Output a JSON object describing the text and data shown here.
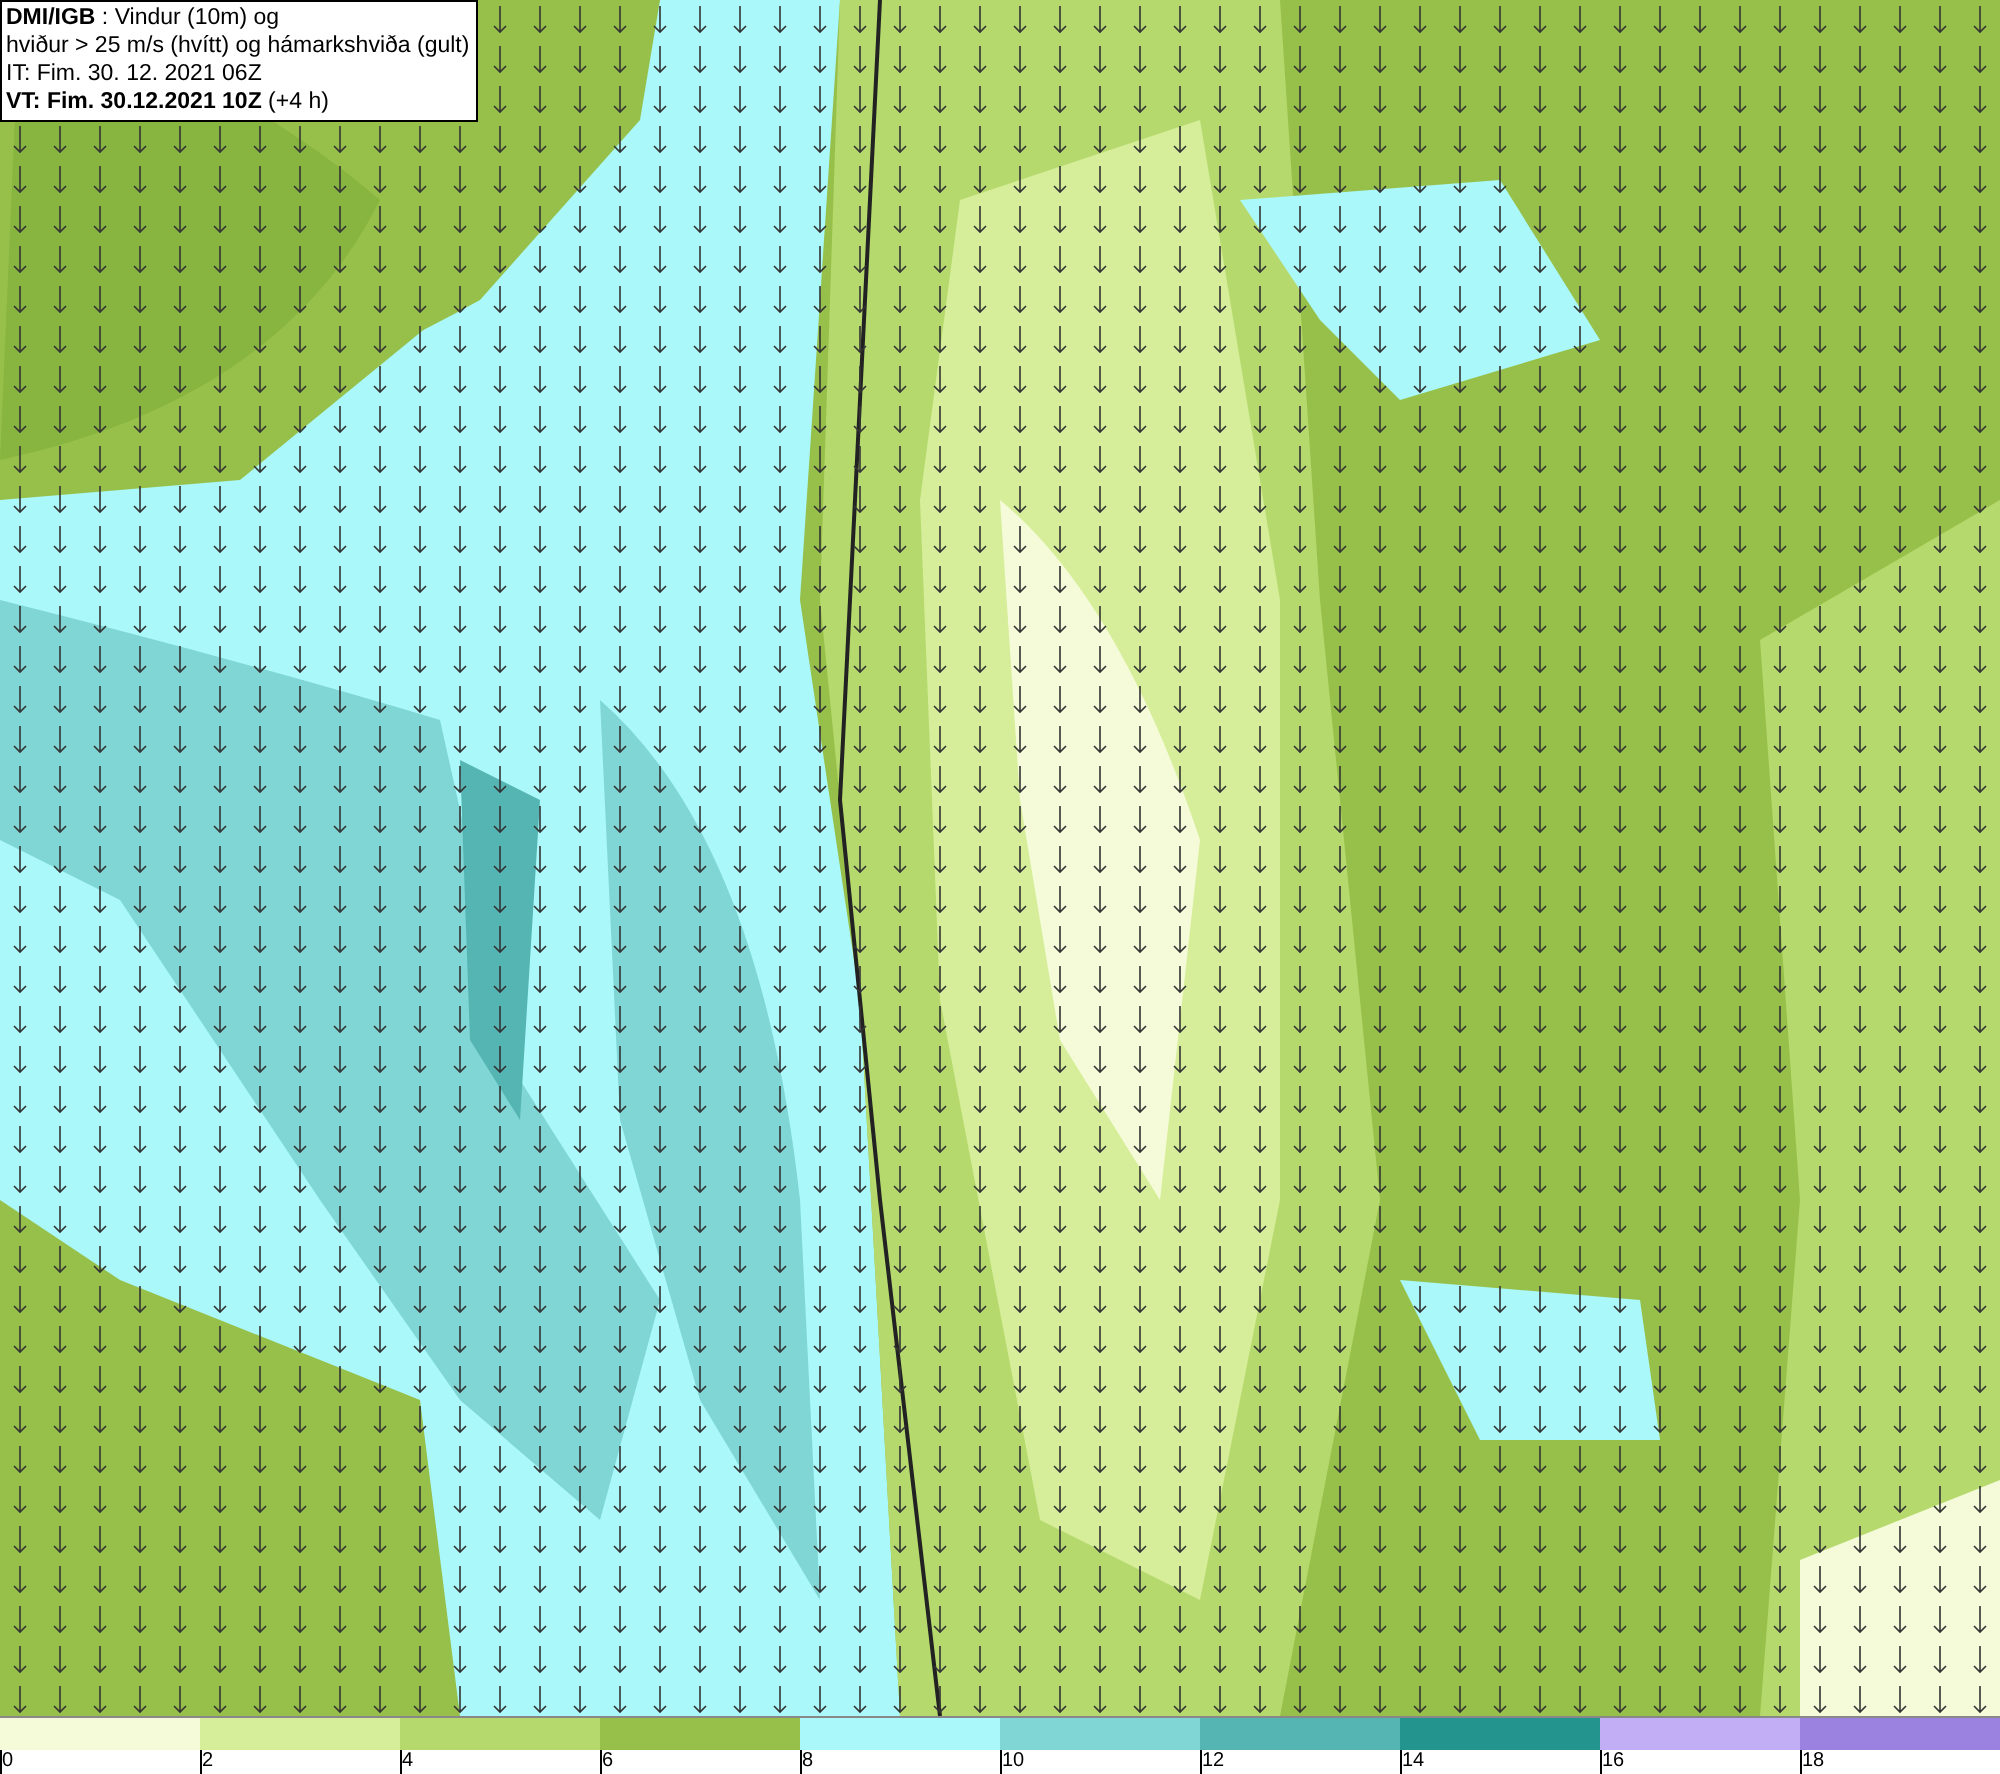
{
  "header": {
    "lines": [
      "**DMI/IGB** : Vindur (10m) og",
      "hviður > 25 m/s (hvítt) og hámarkshviða (gult)",
      "IT: Fim. 30. 12. 2021 06Z",
      "**VT: Fim. 30.12.2021 10Z** (+4 h)"
    ]
  },
  "legend": {
    "bins": [
      {
        "label": "0",
        "color": "#f5fbd8"
      },
      {
        "label": "2",
        "color": "#d6ee9a"
      },
      {
        "label": "4",
        "color": "#b5d96c"
      },
      {
        "label": "6",
        "color": "#97c04a"
      },
      {
        "label": "8",
        "color": "#aaf8fa"
      },
      {
        "label": "10",
        "color": "#7fd6d4"
      },
      {
        "label": "12",
        "color": "#55b5b3"
      },
      {
        "label": "14",
        "color": "#24948e"
      },
      {
        "label": "16",
        "color": "#c2aef5"
      },
      {
        "label": "18",
        "color": "#9b82e0"
      }
    ]
  }
}
